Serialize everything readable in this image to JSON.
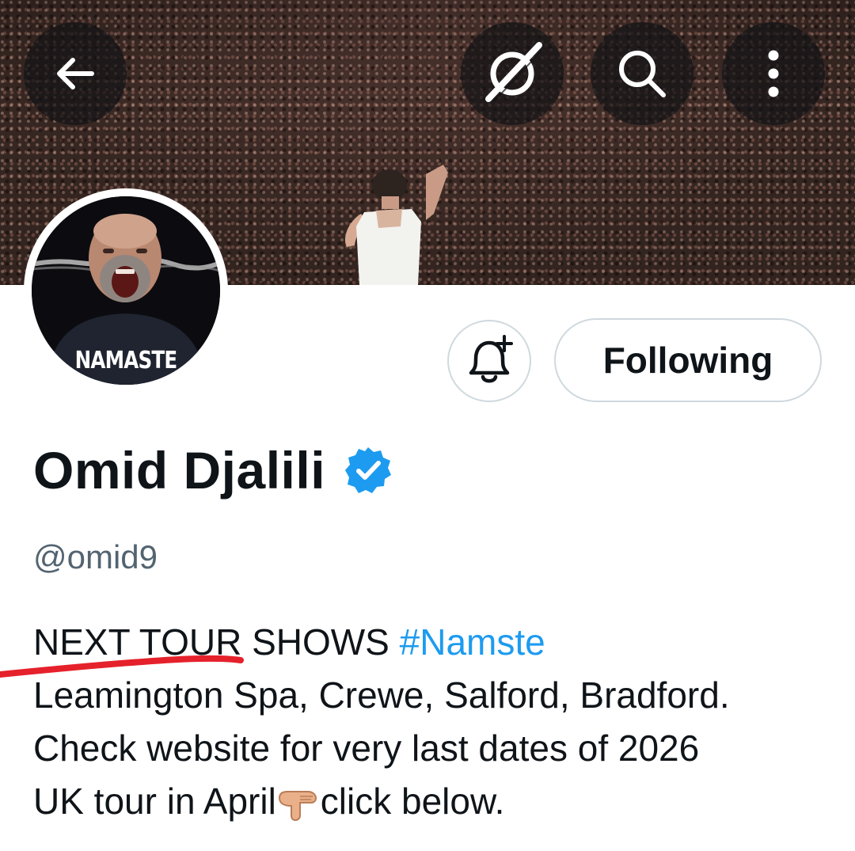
{
  "header": {
    "back_icon": "arrow-left-icon",
    "grok_icon": "grok-icon",
    "search_icon": "search-icon",
    "more_icon": "more-vertical-icon"
  },
  "avatar": {
    "shirt_text": "NAMASTE"
  },
  "actions": {
    "notify_icon": "bell-plus-icon",
    "following_label": "Following"
  },
  "profile": {
    "display_name": "Omid Djalili",
    "verified": true,
    "verified_color": "#1d9bf0",
    "handle": "@omid9"
  },
  "bio": {
    "line1_text": "NEXT TOUR SHOWS ",
    "line1_hashtag": "#Namste",
    "line2": "Leamington Spa, Crewe, Salford, Bradford.",
    "line3": "Check website for very last dates of 2026",
    "line4_start": "UK tour in April",
    "line4_emoji": "backhand-index-pointing-down",
    "line4_end": "click below.",
    "hashtag_color": "#1d9bf0"
  },
  "annotation": {
    "color": "#e5212b"
  }
}
